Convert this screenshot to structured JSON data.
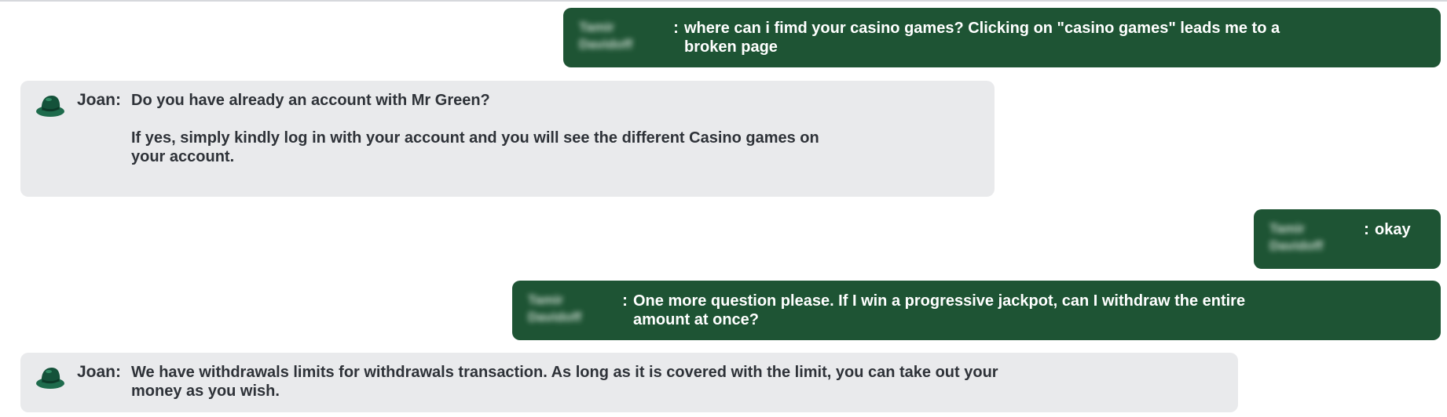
{
  "theme": {
    "user_bubble_color": "#1e5434",
    "agent_bubble_color": "#e9eaec",
    "agent_text_color": "#2e3238",
    "user_text_color": "#ffffff"
  },
  "messages": [
    {
      "role": "user",
      "sender": "Tamir Davidoff",
      "separator": ":",
      "text": "where can i fimd your casino games? Clicking on \"casino games\" leads me to a\nbroken page"
    },
    {
      "role": "agent",
      "sender": "Joan:",
      "avatar_icon": "green-hat-icon",
      "text": "Do you have already an account with Mr Green?\n\nIf yes, simply kindly log in with your account and you will see the different Casino games on\nyour account."
    },
    {
      "role": "user",
      "sender": "Tamir Davidoff",
      "separator": ":",
      "text": "okay"
    },
    {
      "role": "user",
      "sender": "Tamir Davidoff",
      "separator": ":",
      "text": "One more question please. If I win a progressive jackpot, can I withdraw the entire\namount at once?"
    },
    {
      "role": "agent",
      "sender": "Joan:",
      "avatar_icon": "green-hat-icon",
      "text": "We have withdrawals limits for withdrawals transaction. As long as it is covered with the limit, you can take out your\nmoney as you wish."
    }
  ]
}
